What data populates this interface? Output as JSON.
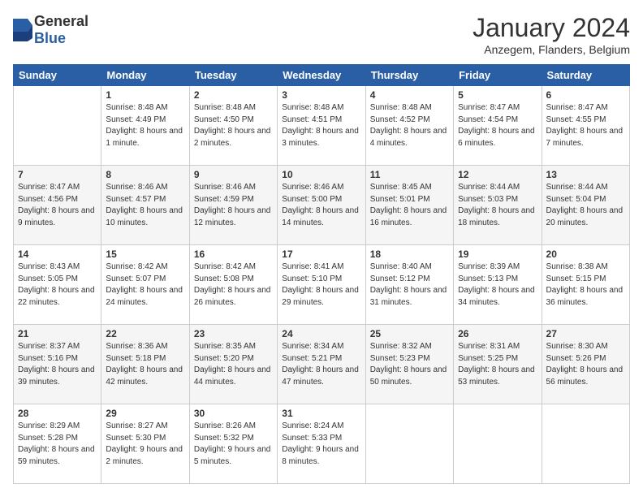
{
  "logo": {
    "general": "General",
    "blue": "Blue"
  },
  "header": {
    "month": "January 2024",
    "location": "Anzegem, Flanders, Belgium"
  },
  "weekdays": [
    "Sunday",
    "Monday",
    "Tuesday",
    "Wednesday",
    "Thursday",
    "Friday",
    "Saturday"
  ],
  "weeks": [
    [
      {
        "date": "",
        "sunrise": "",
        "sunset": "",
        "daylight": ""
      },
      {
        "date": "1",
        "sunrise": "Sunrise: 8:48 AM",
        "sunset": "Sunset: 4:49 PM",
        "daylight": "Daylight: 8 hours and 1 minute."
      },
      {
        "date": "2",
        "sunrise": "Sunrise: 8:48 AM",
        "sunset": "Sunset: 4:50 PM",
        "daylight": "Daylight: 8 hours and 2 minutes."
      },
      {
        "date": "3",
        "sunrise": "Sunrise: 8:48 AM",
        "sunset": "Sunset: 4:51 PM",
        "daylight": "Daylight: 8 hours and 3 minutes."
      },
      {
        "date": "4",
        "sunrise": "Sunrise: 8:48 AM",
        "sunset": "Sunset: 4:52 PM",
        "daylight": "Daylight: 8 hours and 4 minutes."
      },
      {
        "date": "5",
        "sunrise": "Sunrise: 8:47 AM",
        "sunset": "Sunset: 4:54 PM",
        "daylight": "Daylight: 8 hours and 6 minutes."
      },
      {
        "date": "6",
        "sunrise": "Sunrise: 8:47 AM",
        "sunset": "Sunset: 4:55 PM",
        "daylight": "Daylight: 8 hours and 7 minutes."
      }
    ],
    [
      {
        "date": "7",
        "sunrise": "Sunrise: 8:47 AM",
        "sunset": "Sunset: 4:56 PM",
        "daylight": "Daylight: 8 hours and 9 minutes."
      },
      {
        "date": "8",
        "sunrise": "Sunrise: 8:46 AM",
        "sunset": "Sunset: 4:57 PM",
        "daylight": "Daylight: 8 hours and 10 minutes."
      },
      {
        "date": "9",
        "sunrise": "Sunrise: 8:46 AM",
        "sunset": "Sunset: 4:59 PM",
        "daylight": "Daylight: 8 hours and 12 minutes."
      },
      {
        "date": "10",
        "sunrise": "Sunrise: 8:46 AM",
        "sunset": "Sunset: 5:00 PM",
        "daylight": "Daylight: 8 hours and 14 minutes."
      },
      {
        "date": "11",
        "sunrise": "Sunrise: 8:45 AM",
        "sunset": "Sunset: 5:01 PM",
        "daylight": "Daylight: 8 hours and 16 minutes."
      },
      {
        "date": "12",
        "sunrise": "Sunrise: 8:44 AM",
        "sunset": "Sunset: 5:03 PM",
        "daylight": "Daylight: 8 hours and 18 minutes."
      },
      {
        "date": "13",
        "sunrise": "Sunrise: 8:44 AM",
        "sunset": "Sunset: 5:04 PM",
        "daylight": "Daylight: 8 hours and 20 minutes."
      }
    ],
    [
      {
        "date": "14",
        "sunrise": "Sunrise: 8:43 AM",
        "sunset": "Sunset: 5:05 PM",
        "daylight": "Daylight: 8 hours and 22 minutes."
      },
      {
        "date": "15",
        "sunrise": "Sunrise: 8:42 AM",
        "sunset": "Sunset: 5:07 PM",
        "daylight": "Daylight: 8 hours and 24 minutes."
      },
      {
        "date": "16",
        "sunrise": "Sunrise: 8:42 AM",
        "sunset": "Sunset: 5:08 PM",
        "daylight": "Daylight: 8 hours and 26 minutes."
      },
      {
        "date": "17",
        "sunrise": "Sunrise: 8:41 AM",
        "sunset": "Sunset: 5:10 PM",
        "daylight": "Daylight: 8 hours and 29 minutes."
      },
      {
        "date": "18",
        "sunrise": "Sunrise: 8:40 AM",
        "sunset": "Sunset: 5:12 PM",
        "daylight": "Daylight: 8 hours and 31 minutes."
      },
      {
        "date": "19",
        "sunrise": "Sunrise: 8:39 AM",
        "sunset": "Sunset: 5:13 PM",
        "daylight": "Daylight: 8 hours and 34 minutes."
      },
      {
        "date": "20",
        "sunrise": "Sunrise: 8:38 AM",
        "sunset": "Sunset: 5:15 PM",
        "daylight": "Daylight: 8 hours and 36 minutes."
      }
    ],
    [
      {
        "date": "21",
        "sunrise": "Sunrise: 8:37 AM",
        "sunset": "Sunset: 5:16 PM",
        "daylight": "Daylight: 8 hours and 39 minutes."
      },
      {
        "date": "22",
        "sunrise": "Sunrise: 8:36 AM",
        "sunset": "Sunset: 5:18 PM",
        "daylight": "Daylight: 8 hours and 42 minutes."
      },
      {
        "date": "23",
        "sunrise": "Sunrise: 8:35 AM",
        "sunset": "Sunset: 5:20 PM",
        "daylight": "Daylight: 8 hours and 44 minutes."
      },
      {
        "date": "24",
        "sunrise": "Sunrise: 8:34 AM",
        "sunset": "Sunset: 5:21 PM",
        "daylight": "Daylight: 8 hours and 47 minutes."
      },
      {
        "date": "25",
        "sunrise": "Sunrise: 8:32 AM",
        "sunset": "Sunset: 5:23 PM",
        "daylight": "Daylight: 8 hours and 50 minutes."
      },
      {
        "date": "26",
        "sunrise": "Sunrise: 8:31 AM",
        "sunset": "Sunset: 5:25 PM",
        "daylight": "Daylight: 8 hours and 53 minutes."
      },
      {
        "date": "27",
        "sunrise": "Sunrise: 8:30 AM",
        "sunset": "Sunset: 5:26 PM",
        "daylight": "Daylight: 8 hours and 56 minutes."
      }
    ],
    [
      {
        "date": "28",
        "sunrise": "Sunrise: 8:29 AM",
        "sunset": "Sunset: 5:28 PM",
        "daylight": "Daylight: 8 hours and 59 minutes."
      },
      {
        "date": "29",
        "sunrise": "Sunrise: 8:27 AM",
        "sunset": "Sunset: 5:30 PM",
        "daylight": "Daylight: 9 hours and 2 minutes."
      },
      {
        "date": "30",
        "sunrise": "Sunrise: 8:26 AM",
        "sunset": "Sunset: 5:32 PM",
        "daylight": "Daylight: 9 hours and 5 minutes."
      },
      {
        "date": "31",
        "sunrise": "Sunrise: 8:24 AM",
        "sunset": "Sunset: 5:33 PM",
        "daylight": "Daylight: 9 hours and 8 minutes."
      },
      {
        "date": "",
        "sunrise": "",
        "sunset": "",
        "daylight": ""
      },
      {
        "date": "",
        "sunrise": "",
        "sunset": "",
        "daylight": ""
      },
      {
        "date": "",
        "sunrise": "",
        "sunset": "",
        "daylight": ""
      }
    ]
  ]
}
